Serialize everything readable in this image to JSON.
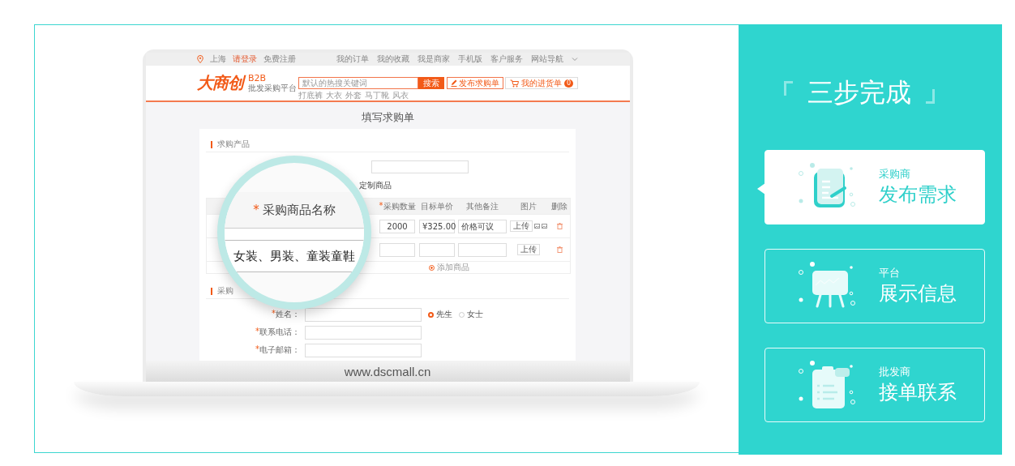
{
  "laptop": {
    "top_bar": {
      "location": "上海",
      "login": "请登录",
      "register": "免费注册",
      "links": [
        "我的订单",
        "我的收藏",
        "我是商家",
        "手机版",
        "客户服务",
        "网站导航"
      ]
    },
    "header": {
      "logo": "大商创",
      "logo_tag": "B2B",
      "logo_sub": "批发采购平台",
      "search": {
        "placeholder": "默认的热搜关键词",
        "button": "搜索"
      },
      "hot_words": [
        "打底裤",
        "大衣",
        "外套",
        "马丁靴",
        "风衣"
      ],
      "post_button": "发布求购单",
      "cart": {
        "label": "我的进货单",
        "count": "0"
      }
    },
    "form": {
      "title": "填写求购单",
      "product_section": "求购产品",
      "custom_option": "定制商品",
      "columns": [
        {
          "mark": "*",
          "label": "采购数量"
        },
        {
          "label": "目标单价"
        },
        {
          "label": "其他备注"
        },
        {
          "label": "图片"
        },
        {
          "label": "删除"
        }
      ],
      "rows": [
        {
          "qty": "2000",
          "price": "¥325.00",
          "note": "价格可议",
          "upload": "上传",
          "has_images": true
        },
        {
          "upload": "上传",
          "has_images": false
        }
      ],
      "add_product": "添加商品",
      "contact_section": "采购",
      "contact_fields": [
        {
          "mark": "*",
          "label": "姓名：",
          "options": [
            {
              "label": "先生",
              "selected": true
            },
            {
              "label": "女士",
              "selected": false
            }
          ]
        },
        {
          "mark": "*",
          "label": "联系电话："
        },
        {
          "mark": "*",
          "label": "电子邮箱："
        }
      ]
    },
    "magnifier": {
      "column": {
        "mark": "*",
        "label": "采购商品名称"
      },
      "value": "女装、男装、童装童鞋"
    },
    "url": "www.dscmall.cn"
  },
  "steps_panel": {
    "title": "三步完成",
    "steps": [
      {
        "kind": "document",
        "role": "采购商",
        "title": "发布需求",
        "selected": true
      },
      {
        "kind": "easel",
        "role": "平台",
        "title": "展示信息",
        "selected": false
      },
      {
        "kind": "clipboard",
        "role": "批发商",
        "title": "接单联系",
        "selected": false
      }
    ]
  }
}
